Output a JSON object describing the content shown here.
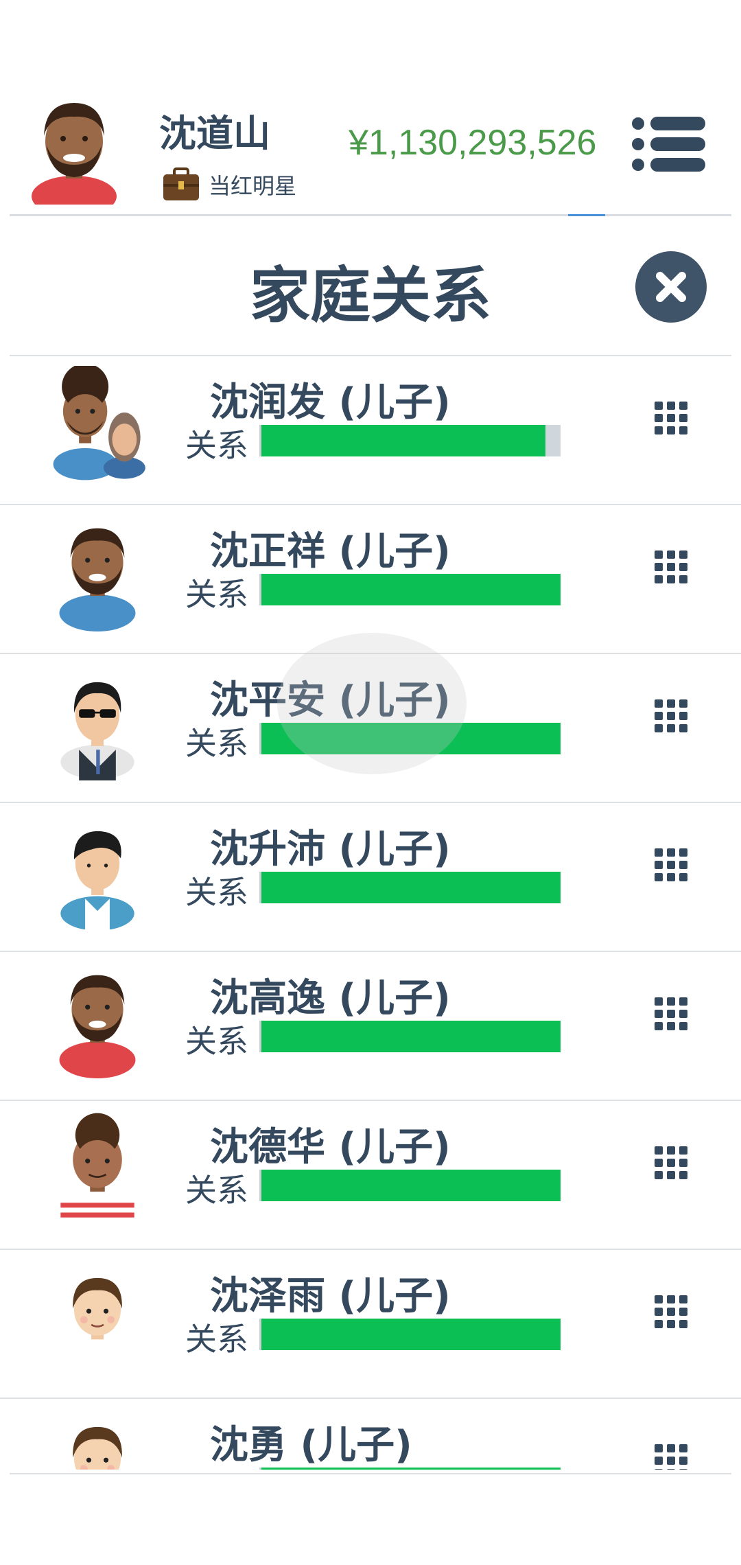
{
  "header": {
    "player_name": "沈道山",
    "job_title": "当红明星",
    "money": "¥1,130,293,526"
  },
  "dialog": {
    "title": "家庭关系",
    "relationship_label": "关系"
  },
  "children": [
    {
      "name": "沈润发 (儿子)",
      "relationship": 0.95,
      "avatar": "afro-man-with-woman-avatar"
    },
    {
      "name": "沈正祥 (儿子)",
      "relationship": 1.0,
      "avatar": "bearded-man-avatar"
    },
    {
      "name": "沈平安 (儿子)",
      "relationship": 1.0,
      "avatar": "sunglasses-man-avatar"
    },
    {
      "name": "沈升沛 (儿子)",
      "relationship": 1.0,
      "avatar": "young-man-avatar"
    },
    {
      "name": "沈高逸 (儿子)",
      "relationship": 1.0,
      "avatar": "bearded-man-red-avatar"
    },
    {
      "name": "沈德华 (儿子)",
      "relationship": 1.0,
      "avatar": "curly-man-striped-avatar"
    },
    {
      "name": "沈泽雨 (儿子)",
      "relationship": 1.0,
      "avatar": "boy-avatar"
    },
    {
      "name": "沈勇 (儿子)",
      "relationship": 1.0,
      "avatar": "boy-avatar"
    }
  ],
  "colors": {
    "money": "#4a9a4a",
    "bar_fill": "#0bbf55",
    "bar_track": "#cfd6dc",
    "text": "#34495e"
  }
}
